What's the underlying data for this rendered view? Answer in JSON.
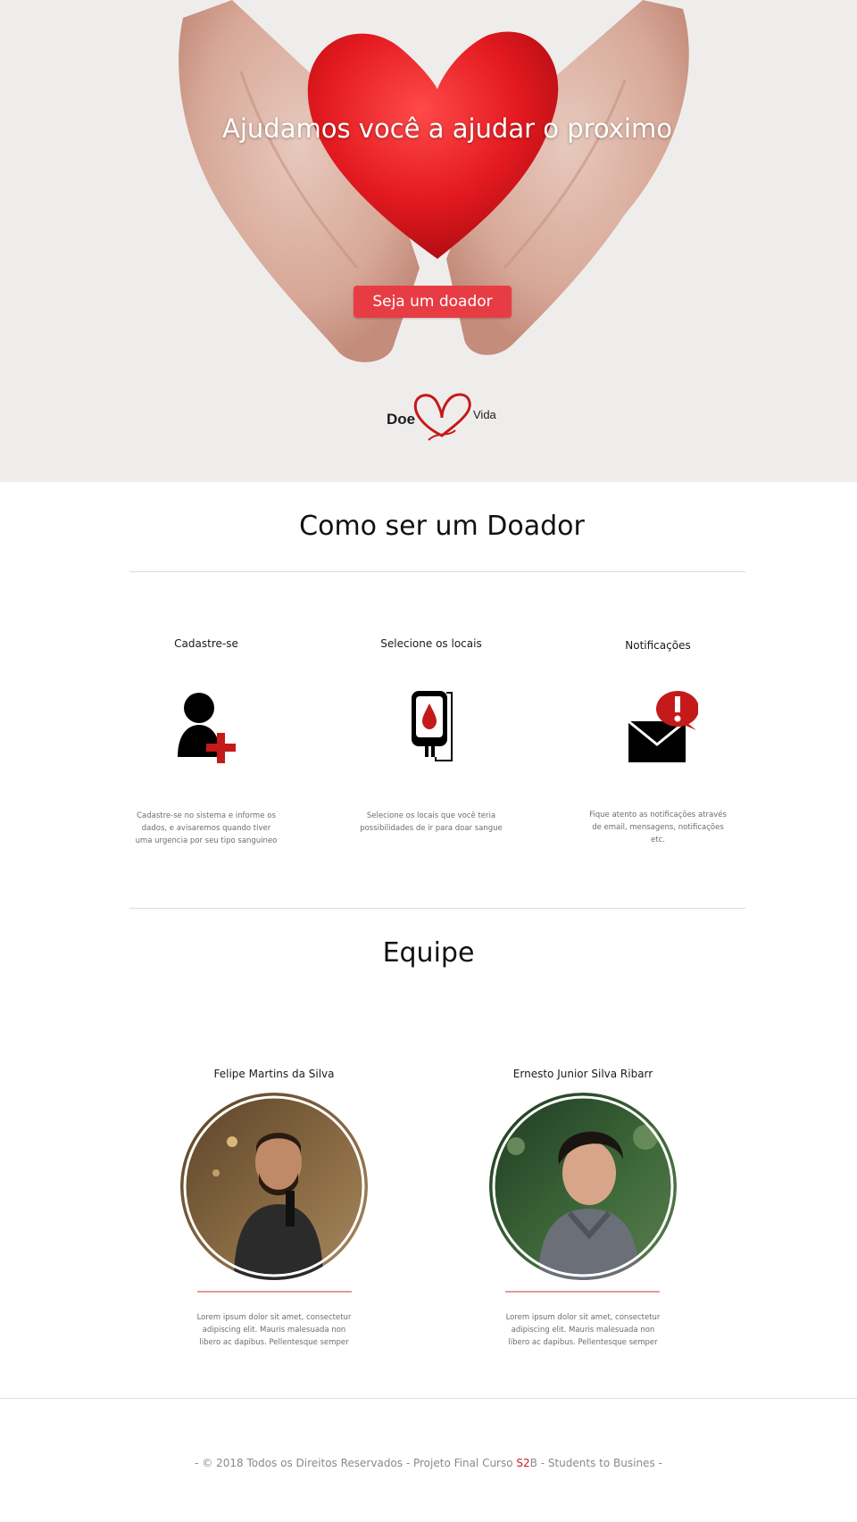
{
  "hero": {
    "headline": "Ajudamos você a ajudar o proximo",
    "cta_label": "Seja um doador",
    "logo": {
      "left_word": "Doe",
      "right_word": "Vida"
    }
  },
  "how_to": {
    "title": "Como ser um Doador",
    "steps": [
      {
        "label": "Cadastre-se",
        "icon": "user-plus-icon",
        "description": "Cadastre-se no sistema e informe os dados, e avisaremos quando tiver uma urgencia por seu tipo sanguineo"
      },
      {
        "label": "Selecione os locais",
        "icon": "blood-bag-icon",
        "description": "Selecione os locais que você teria possibilidades de ir para doar sangue"
      },
      {
        "label": "Notificações",
        "icon": "mail-alert-icon",
        "description": "Fique atento as notificações através de email, mensagens, notificações etc."
      }
    ]
  },
  "team": {
    "title": "Equipe",
    "members": [
      {
        "name": "Felipe Martins da Silva",
        "bio": "Lorem ipsum dolor sit amet, consectetur adipiscing elit. Mauris malesuada non libero ac dapibus. Pellentesque semper"
      },
      {
        "name": "Ernesto Junior Silva Ribarr",
        "bio": "Lorem ipsum dolor sit amet, consectetur adipiscing elit. Mauris malesuada non libero ac dapibus. Pellentesque semper"
      }
    ]
  },
  "footer": {
    "prefix": "- © 2018 Todos os Direitos Reservados - Projeto Final Curso ",
    "accent": "S2",
    "suffix": "B - Students to Busines -"
  },
  "colors": {
    "accent": "#e83c45",
    "brand_red": "#c41a1a",
    "footer_accent": "#d11a1a"
  }
}
